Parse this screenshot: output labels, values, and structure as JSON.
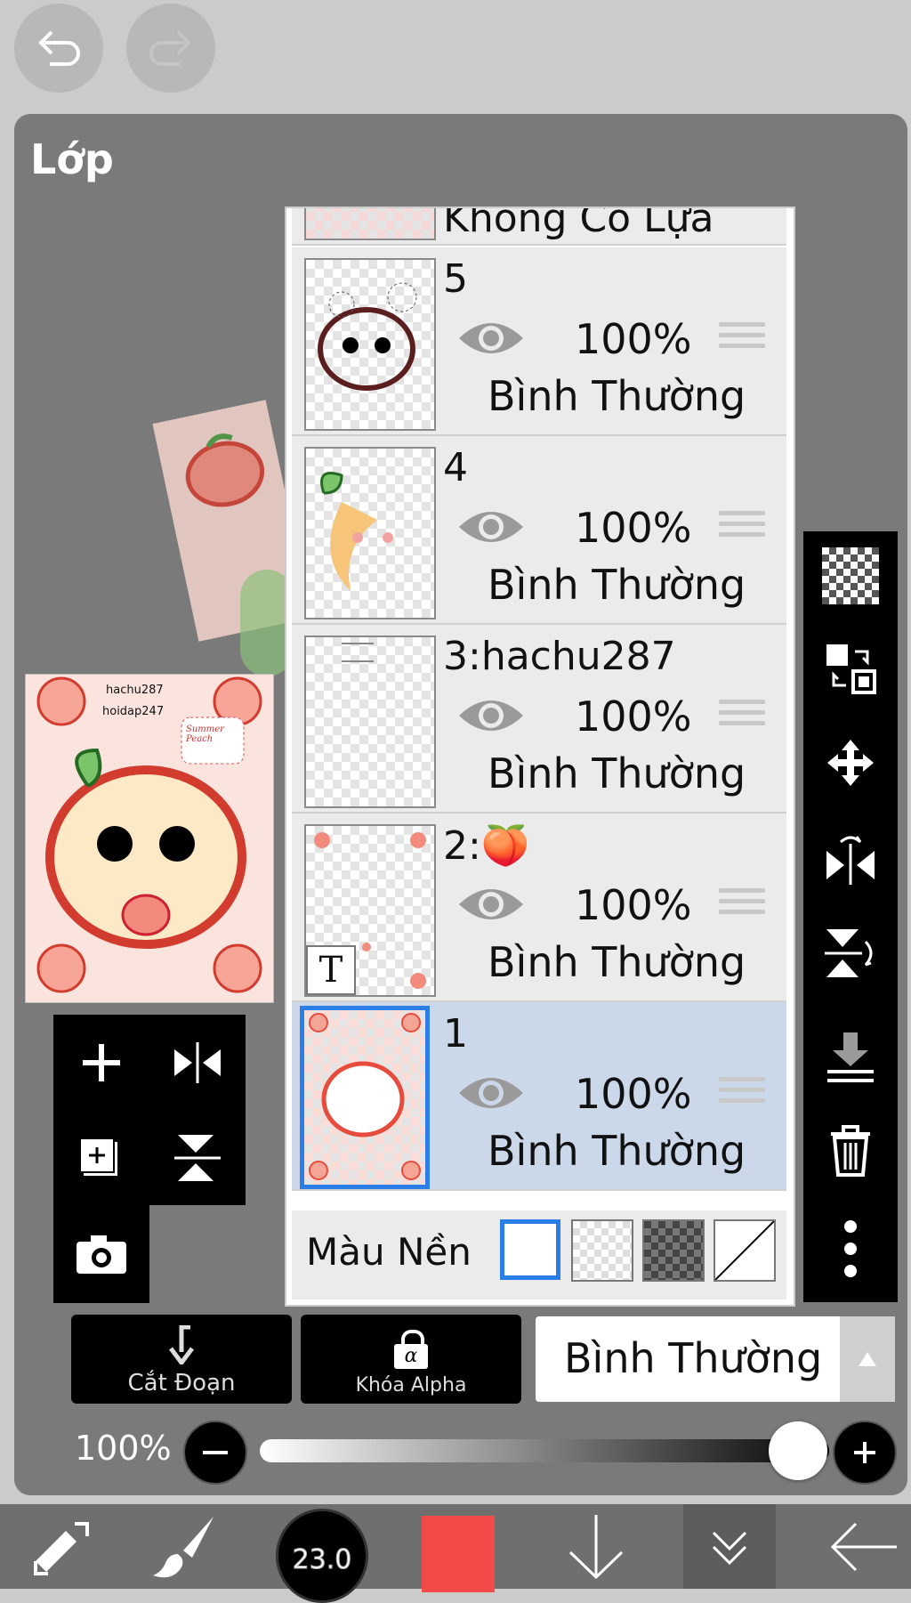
{
  "panel": {
    "title": "Lớp"
  },
  "preview": {
    "line1": "hachu287",
    "line2": "hoidap247",
    "bubble": "Summer Peach"
  },
  "layers": [
    {
      "name": "Không Có Lựa Chọn"
    },
    {
      "name": "5",
      "opacity": "100%",
      "blend": "Bình Thường"
    },
    {
      "name": "4",
      "opacity": "100%",
      "blend": "Bình Thường"
    },
    {
      "name": "3:hachu287",
      "opacity": "100%",
      "blend": "Bình Thường"
    },
    {
      "name": "2:",
      "emoji": "🍑",
      "opacity": "100%",
      "blend": "Bình Thường"
    },
    {
      "name": "1",
      "opacity": "100%",
      "blend": "Bình Thường",
      "selected": true
    }
  ],
  "background": {
    "label": "Màu Nền"
  },
  "buttons": {
    "clipping": "Cắt Đoạn",
    "alpha_lock": "Khóa Alpha",
    "alpha_symbol": "α",
    "blend_mode": "Bình Thường"
  },
  "opacity_slider": {
    "label": "100%",
    "value": 1.0
  },
  "bottom": {
    "brush_size": "23.0",
    "color": "#f34a4a"
  },
  "colors": {
    "selection": "#2b7ee6",
    "selected_row": "#cbd8ea"
  }
}
